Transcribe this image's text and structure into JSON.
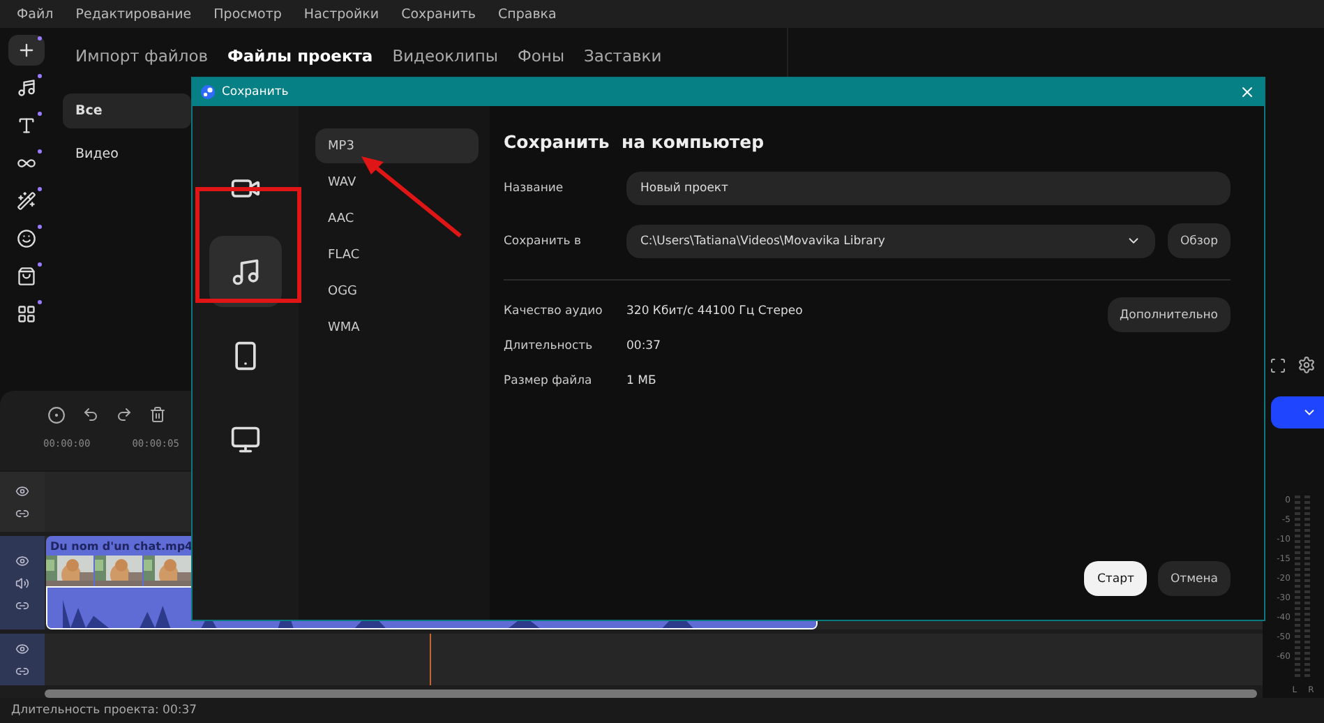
{
  "menu": [
    "Файл",
    "Редактирование",
    "Просмотр",
    "Настройки",
    "Сохранить",
    "Справка"
  ],
  "tool_rail": [
    {
      "kind": "add"
    },
    {
      "kind": "music"
    },
    {
      "kind": "text"
    },
    {
      "kind": "transitions"
    },
    {
      "kind": "effects"
    },
    {
      "kind": "stickers"
    },
    {
      "kind": "store"
    },
    {
      "kind": "more"
    }
  ],
  "tabs": [
    {
      "label": "Импорт файлов",
      "selected": false
    },
    {
      "label": "Файлы проекта",
      "selected": true
    },
    {
      "label": "Видеоклипы",
      "selected": false
    },
    {
      "label": "Фоны",
      "selected": false
    },
    {
      "label": "Заставки",
      "selected": false
    }
  ],
  "media_categories": [
    {
      "label": "Все",
      "selected": true
    },
    {
      "label": "Видео",
      "selected": false
    }
  ],
  "timeline": {
    "ruler": [
      "00:00:00",
      "00:00:05"
    ],
    "tracks": [
      {
        "kind": "empty",
        "selected": false
      },
      {
        "kind": "clip",
        "selected": true,
        "clip_title": "Du nom d'un chat.mp4"
      },
      {
        "kind": "empty",
        "selected": true
      }
    ]
  },
  "meter": {
    "scale": [
      "0",
      "-5",
      "-10",
      "-15",
      "-20",
      "-30",
      "-40",
      "-50",
      "-60"
    ],
    "channels": [
      "L",
      "R"
    ]
  },
  "status_bar": "Длительность проекта: 00:37",
  "dialog": {
    "title": "Сохранить",
    "categories": [
      {
        "kind": "video",
        "selected": false
      },
      {
        "kind": "audio",
        "selected": true
      },
      {
        "kind": "mobile",
        "selected": false
      },
      {
        "kind": "tv",
        "selected": false
      }
    ],
    "formats": [
      {
        "label": "MP3",
        "selected": true
      },
      {
        "label": "WAV",
        "selected": false
      },
      {
        "label": "AAC",
        "selected": false
      },
      {
        "label": "FLAC",
        "selected": false
      },
      {
        "label": "OGG",
        "selected": false
      },
      {
        "label": "WMA",
        "selected": false
      }
    ],
    "heading": "Сохранить  на компьютер",
    "name_field": {
      "label": "Название",
      "value": "Новый проект"
    },
    "location_field": {
      "label": "Сохранить в",
      "value": "C:\\Users\\Tatiana\\Videos\\Movavika Library"
    },
    "browse_button": "Обзор",
    "info": [
      {
        "label": "Качество аудио",
        "value": "320 Кбит/с 44100 Гц Стерео"
      },
      {
        "label": "Длительность",
        "value": "00:37"
      },
      {
        "label": "Размер файла",
        "value": "1 МБ"
      }
    ],
    "advanced_button": "Дополнительно",
    "buttons": [
      {
        "label": "Старт",
        "kind": "primary"
      },
      {
        "label": "Отмена",
        "kind": "secondary"
      }
    ]
  }
}
